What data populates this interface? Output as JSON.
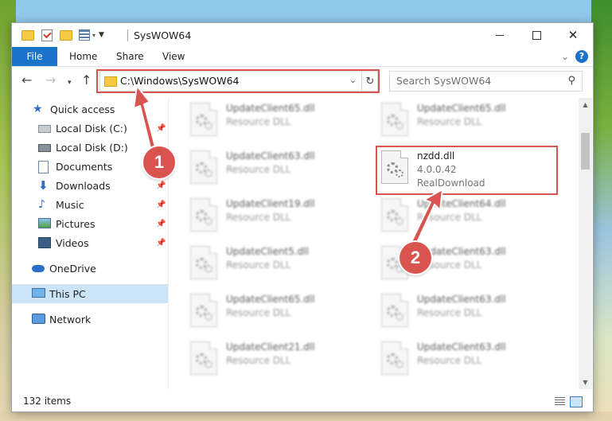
{
  "title_bar": {
    "title": "SysWOW64"
  },
  "ribbon": {
    "file_tab": "File",
    "tabs": [
      "Home",
      "Share",
      "View"
    ],
    "help": "?"
  },
  "address": {
    "path": "C:\\Windows\\SysWOW64"
  },
  "search": {
    "placeholder": "Search SysWOW64"
  },
  "sidebar": {
    "items": [
      {
        "label": "Quick access",
        "icon": "star-icon",
        "pinned": false
      },
      {
        "label": "Local Disk (C:)",
        "icon": "drive-icon",
        "pinned": true
      },
      {
        "label": "Local Disk (D:)",
        "icon": "drive-icon",
        "pinned": false
      },
      {
        "label": "Documents",
        "icon": "document-icon",
        "pinned": true
      },
      {
        "label": "Downloads",
        "icon": "download-icon",
        "pinned": true
      },
      {
        "label": "Music",
        "icon": "music-icon",
        "pinned": true
      },
      {
        "label": "Pictures",
        "icon": "pictures-icon",
        "pinned": true
      },
      {
        "label": "Videos",
        "icon": "videos-icon",
        "pinned": true
      },
      {
        "label": "OneDrive",
        "icon": "cloud-icon",
        "pinned": false
      },
      {
        "label": "This PC",
        "icon": "pc-icon",
        "pinned": false,
        "selected": true
      },
      {
        "label": "Network",
        "icon": "network-icon",
        "pinned": false
      }
    ]
  },
  "files": [
    {
      "name": "UpdateClient65.dll",
      "type": "Resource DLL"
    },
    {
      "name": "UpdateClient65.dll",
      "type": "Resource DLL"
    },
    {
      "name": "UpdateClient63.dll",
      "type": "Resource DLL"
    },
    {
      "name": "nzdd.dll",
      "version": "4.0.0.42",
      "company": "RealDownload",
      "highlighted": true
    },
    {
      "name": "UpdateClient19.dll",
      "type": "Resource DLL"
    },
    {
      "name": "UpdateClient64.dll",
      "type": "Resource DLL"
    },
    {
      "name": "UpdateClient5.dll",
      "type": "Resource DLL"
    },
    {
      "name": "UpdateClient63.dll",
      "type": "Resource DLL"
    },
    {
      "name": "UpdateClient65.dll",
      "type": "Resource DLL"
    },
    {
      "name": "UpdateClient63.dll",
      "type": "Resource DLL"
    },
    {
      "name": "UpdateClient21.dll",
      "type": "Resource DLL"
    },
    {
      "name": "UpdateClient63.dll",
      "type": "Resource DLL"
    }
  ],
  "status": {
    "count": "132 items"
  },
  "callouts": {
    "one": "1",
    "two": "2"
  },
  "colors": {
    "accent": "#1a73c9",
    "highlight": "#d9534f",
    "selected": "#cce4f7"
  }
}
